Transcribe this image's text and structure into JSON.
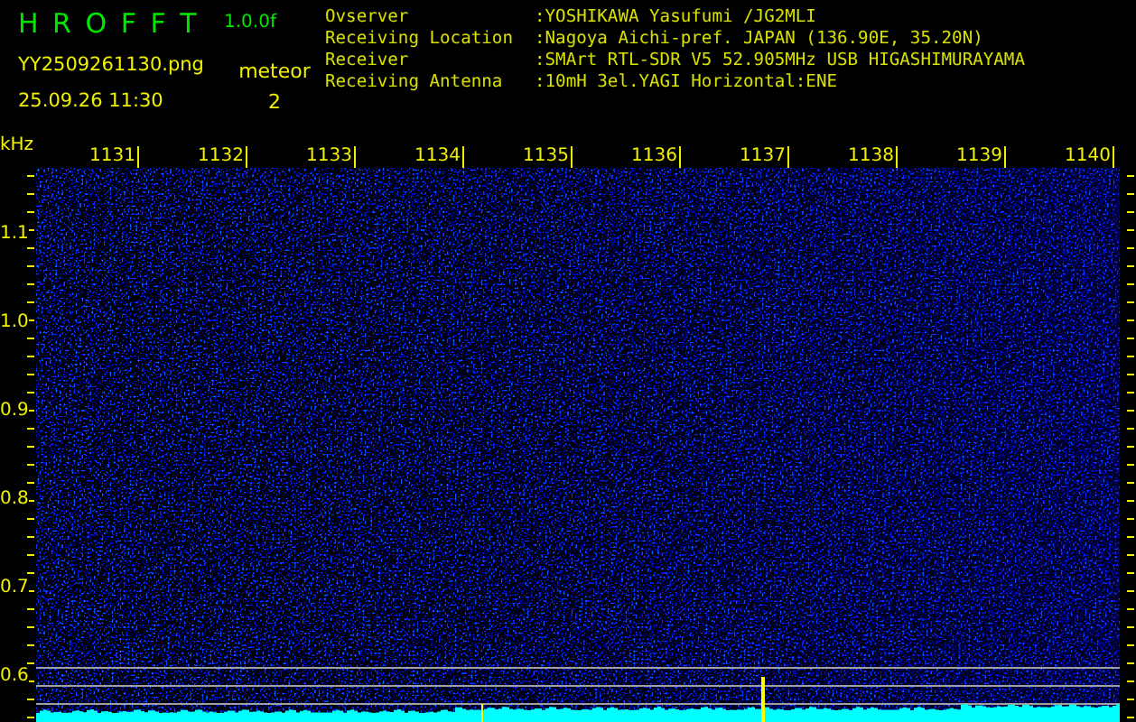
{
  "app": {
    "title": "H R O F F T",
    "version": "1.0.0f"
  },
  "file": {
    "name": "YY2509261130.png",
    "timestamp": "25.09.26 11:30"
  },
  "detection": {
    "label": "meteor",
    "count": "2"
  },
  "station_info": [
    {
      "label": "Ovserver",
      "value": ":YOSHIKAWA Yasufumi /JG2MLI"
    },
    {
      "label": "Receiving Location",
      "value": ":Nagoya Aichi-pref. JAPAN (136.90E, 35.20N)"
    },
    {
      "label": "Receiver",
      "value": ":SMArt RTL-SDR V5 52.905MHz USB HIGASHIMURAYAMA"
    },
    {
      "label": "Receiving Antenna",
      "value": ":10mH 3el.YAGI Horizontal:ENE"
    }
  ],
  "frequency_axis": {
    "unit": "kHz",
    "labels": [
      "1131",
      "1132",
      "1133",
      "1134",
      "1135",
      "1136",
      "1137",
      "1138",
      "1139",
      "1140"
    ]
  },
  "time_axis": {
    "labels": [
      "1.1",
      "1.0",
      "0.9",
      "0.8",
      "0.7",
      "0.6"
    ]
  }
}
